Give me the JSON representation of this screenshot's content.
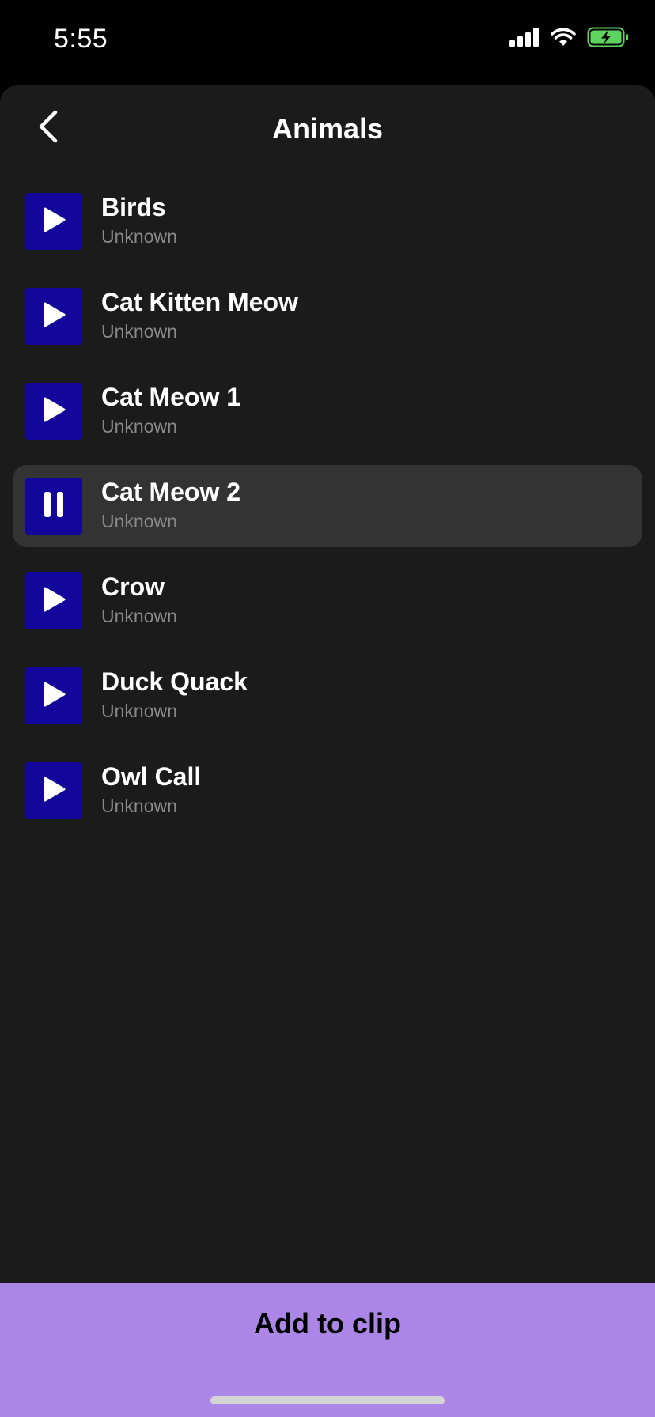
{
  "status": {
    "time": "5:55"
  },
  "header": {
    "title": "Animals"
  },
  "tracks": [
    {
      "title": "Birds",
      "subtitle": "Unknown",
      "state": "play"
    },
    {
      "title": "Cat Kitten Meow",
      "subtitle": "Unknown",
      "state": "play"
    },
    {
      "title": "Cat Meow 1",
      "subtitle": "Unknown",
      "state": "play"
    },
    {
      "title": "Cat Meow 2",
      "subtitle": "Unknown",
      "state": "pause"
    },
    {
      "title": "Crow",
      "subtitle": "Unknown",
      "state": "play"
    },
    {
      "title": "Duck Quack",
      "subtitle": "Unknown",
      "state": "play"
    },
    {
      "title": "Owl Call",
      "subtitle": "Unknown",
      "state": "play"
    }
  ],
  "footer": {
    "button_label": "Add to clip"
  },
  "colors": {
    "accent": "#ac86e6",
    "play_button": "#12079a",
    "background": "#1b1b1b",
    "active_row": "#333333",
    "battery_fill": "#5fd35f"
  },
  "icons": {
    "back": "chevron-left-icon",
    "play": "play-icon",
    "pause": "pause-icon",
    "signal": "cellular-signal-icon",
    "wifi": "wifi-icon",
    "battery": "battery-charging-icon"
  }
}
